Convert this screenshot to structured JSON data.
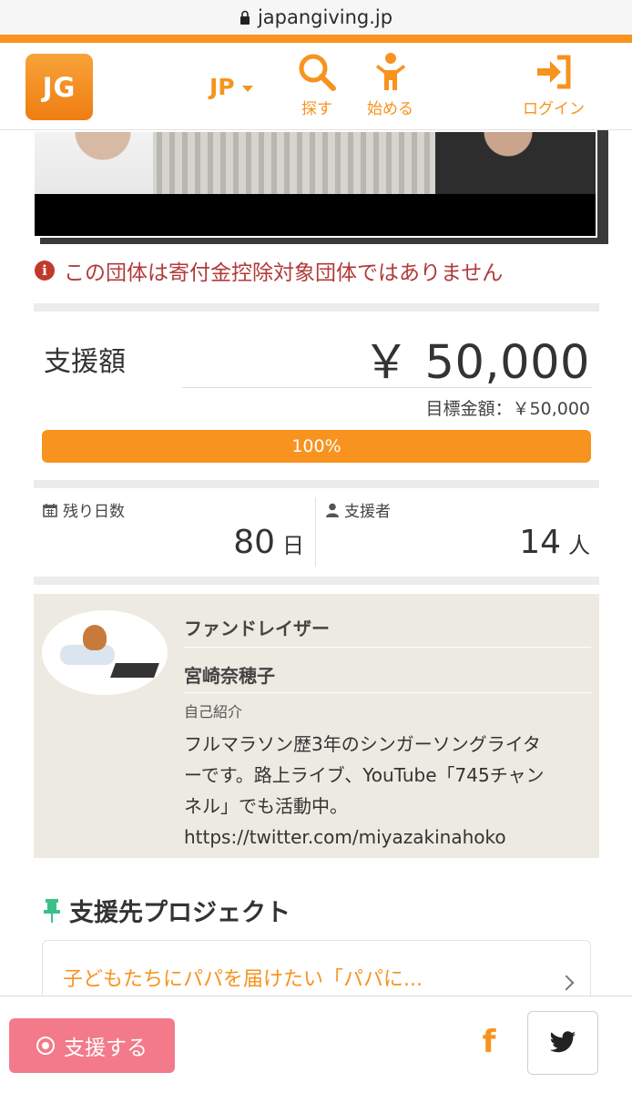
{
  "browser": {
    "url": "japangiving.jp"
  },
  "header": {
    "logo_text": "JG",
    "language": "JP",
    "nav": [
      {
        "label": "探す",
        "icon": "search-icon"
      },
      {
        "label": "始める",
        "icon": "person-icon"
      },
      {
        "label": "ログイン",
        "icon": "login-icon"
      }
    ]
  },
  "notice": {
    "icon": "info-icon",
    "text": "この団体は寄付金控除対象団体ではありません"
  },
  "funding": {
    "label": "支援額",
    "amount": "￥ 50,000",
    "target": "目標金額：￥50,000",
    "progress_label": "100%",
    "progress_fraction": 1.0
  },
  "stats": {
    "days_label": "残り日数",
    "days_value": "80",
    "days_unit": "日",
    "supporters_label": "支援者",
    "supporters_value": "14",
    "supporters_unit": "人"
  },
  "fundraiser": {
    "role": "ファンドレイザー",
    "name": "宮崎奈穂子",
    "intro_label": "自己紹介",
    "intro_lines": [
      "フルマラソン歴3年のシンガーソングライタ",
      "ーです。路上ライブ、YouTube「745チャン",
      "ネル」でも活動中。",
      "https://twitter.com/miyazakinahoko"
    ]
  },
  "project": {
    "heading": "支援先プロジェクト",
    "title": "子どもたちにパパを届けたい「パパに..."
  },
  "bottom": {
    "support_button": "支援する",
    "facebook": "f",
    "colors": {
      "accent": "#f7931e",
      "support": "#f27a8a",
      "notice": "#b23a3a"
    }
  }
}
